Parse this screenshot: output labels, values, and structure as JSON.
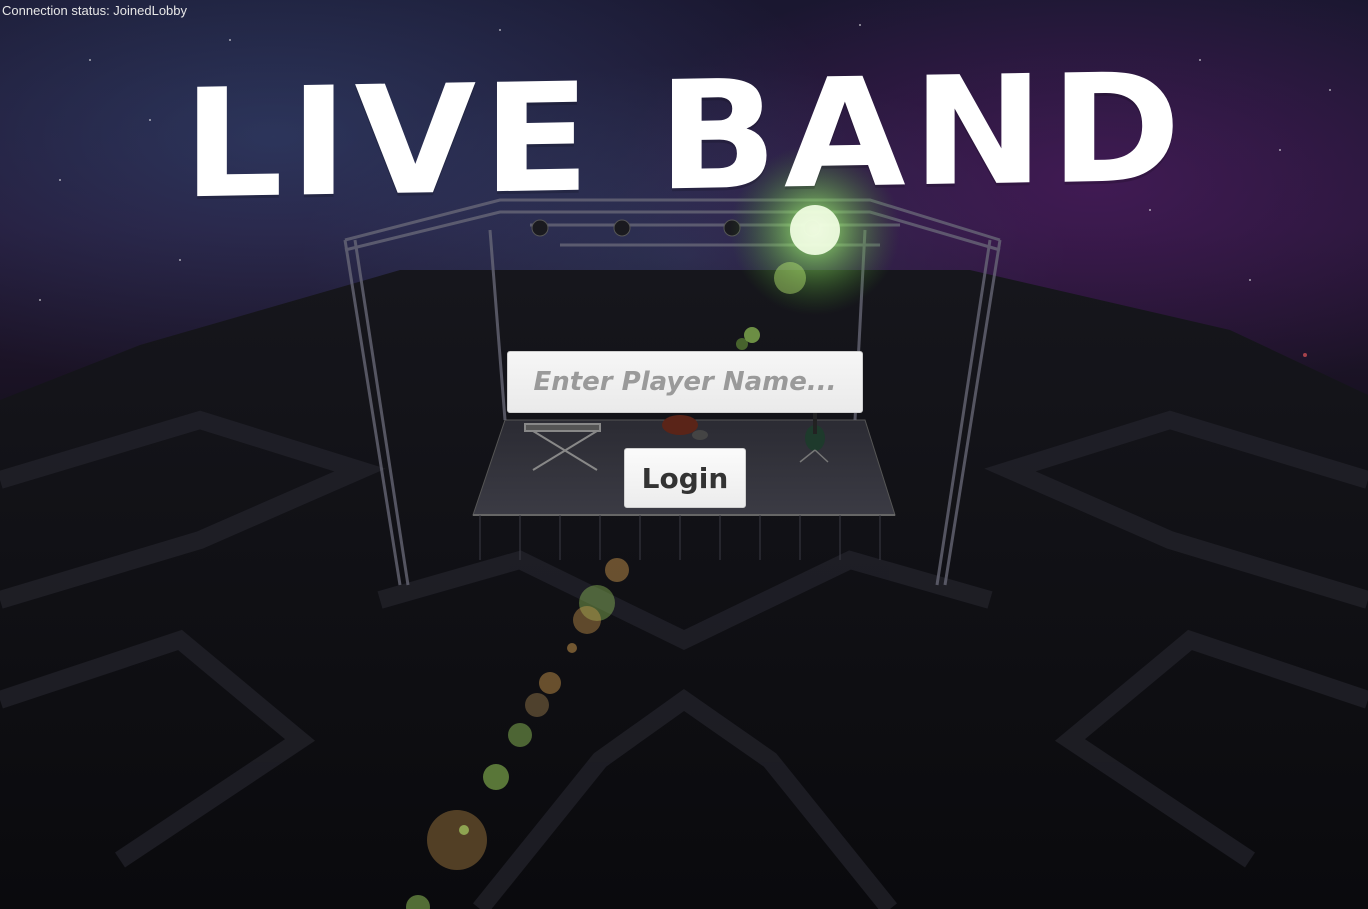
{
  "status": {
    "text": "Connection status: JoinedLobby"
  },
  "game": {
    "title": "LIVE BAND"
  },
  "login_form": {
    "name_placeholder": "Enter Player Name...",
    "name_value": "",
    "login_label": "Login"
  },
  "colors": {
    "title": "#ffffff",
    "spotlight": "#9dff6a",
    "sky_purple": "#2a1538",
    "floor": "#0d0d12"
  },
  "icons": {
    "stage": "stage-truss",
    "spotlight": "spotlight-glow",
    "keyboard": "keyboard-instrument",
    "guitar": "guitar-instrument",
    "drums": "drum-kit"
  }
}
